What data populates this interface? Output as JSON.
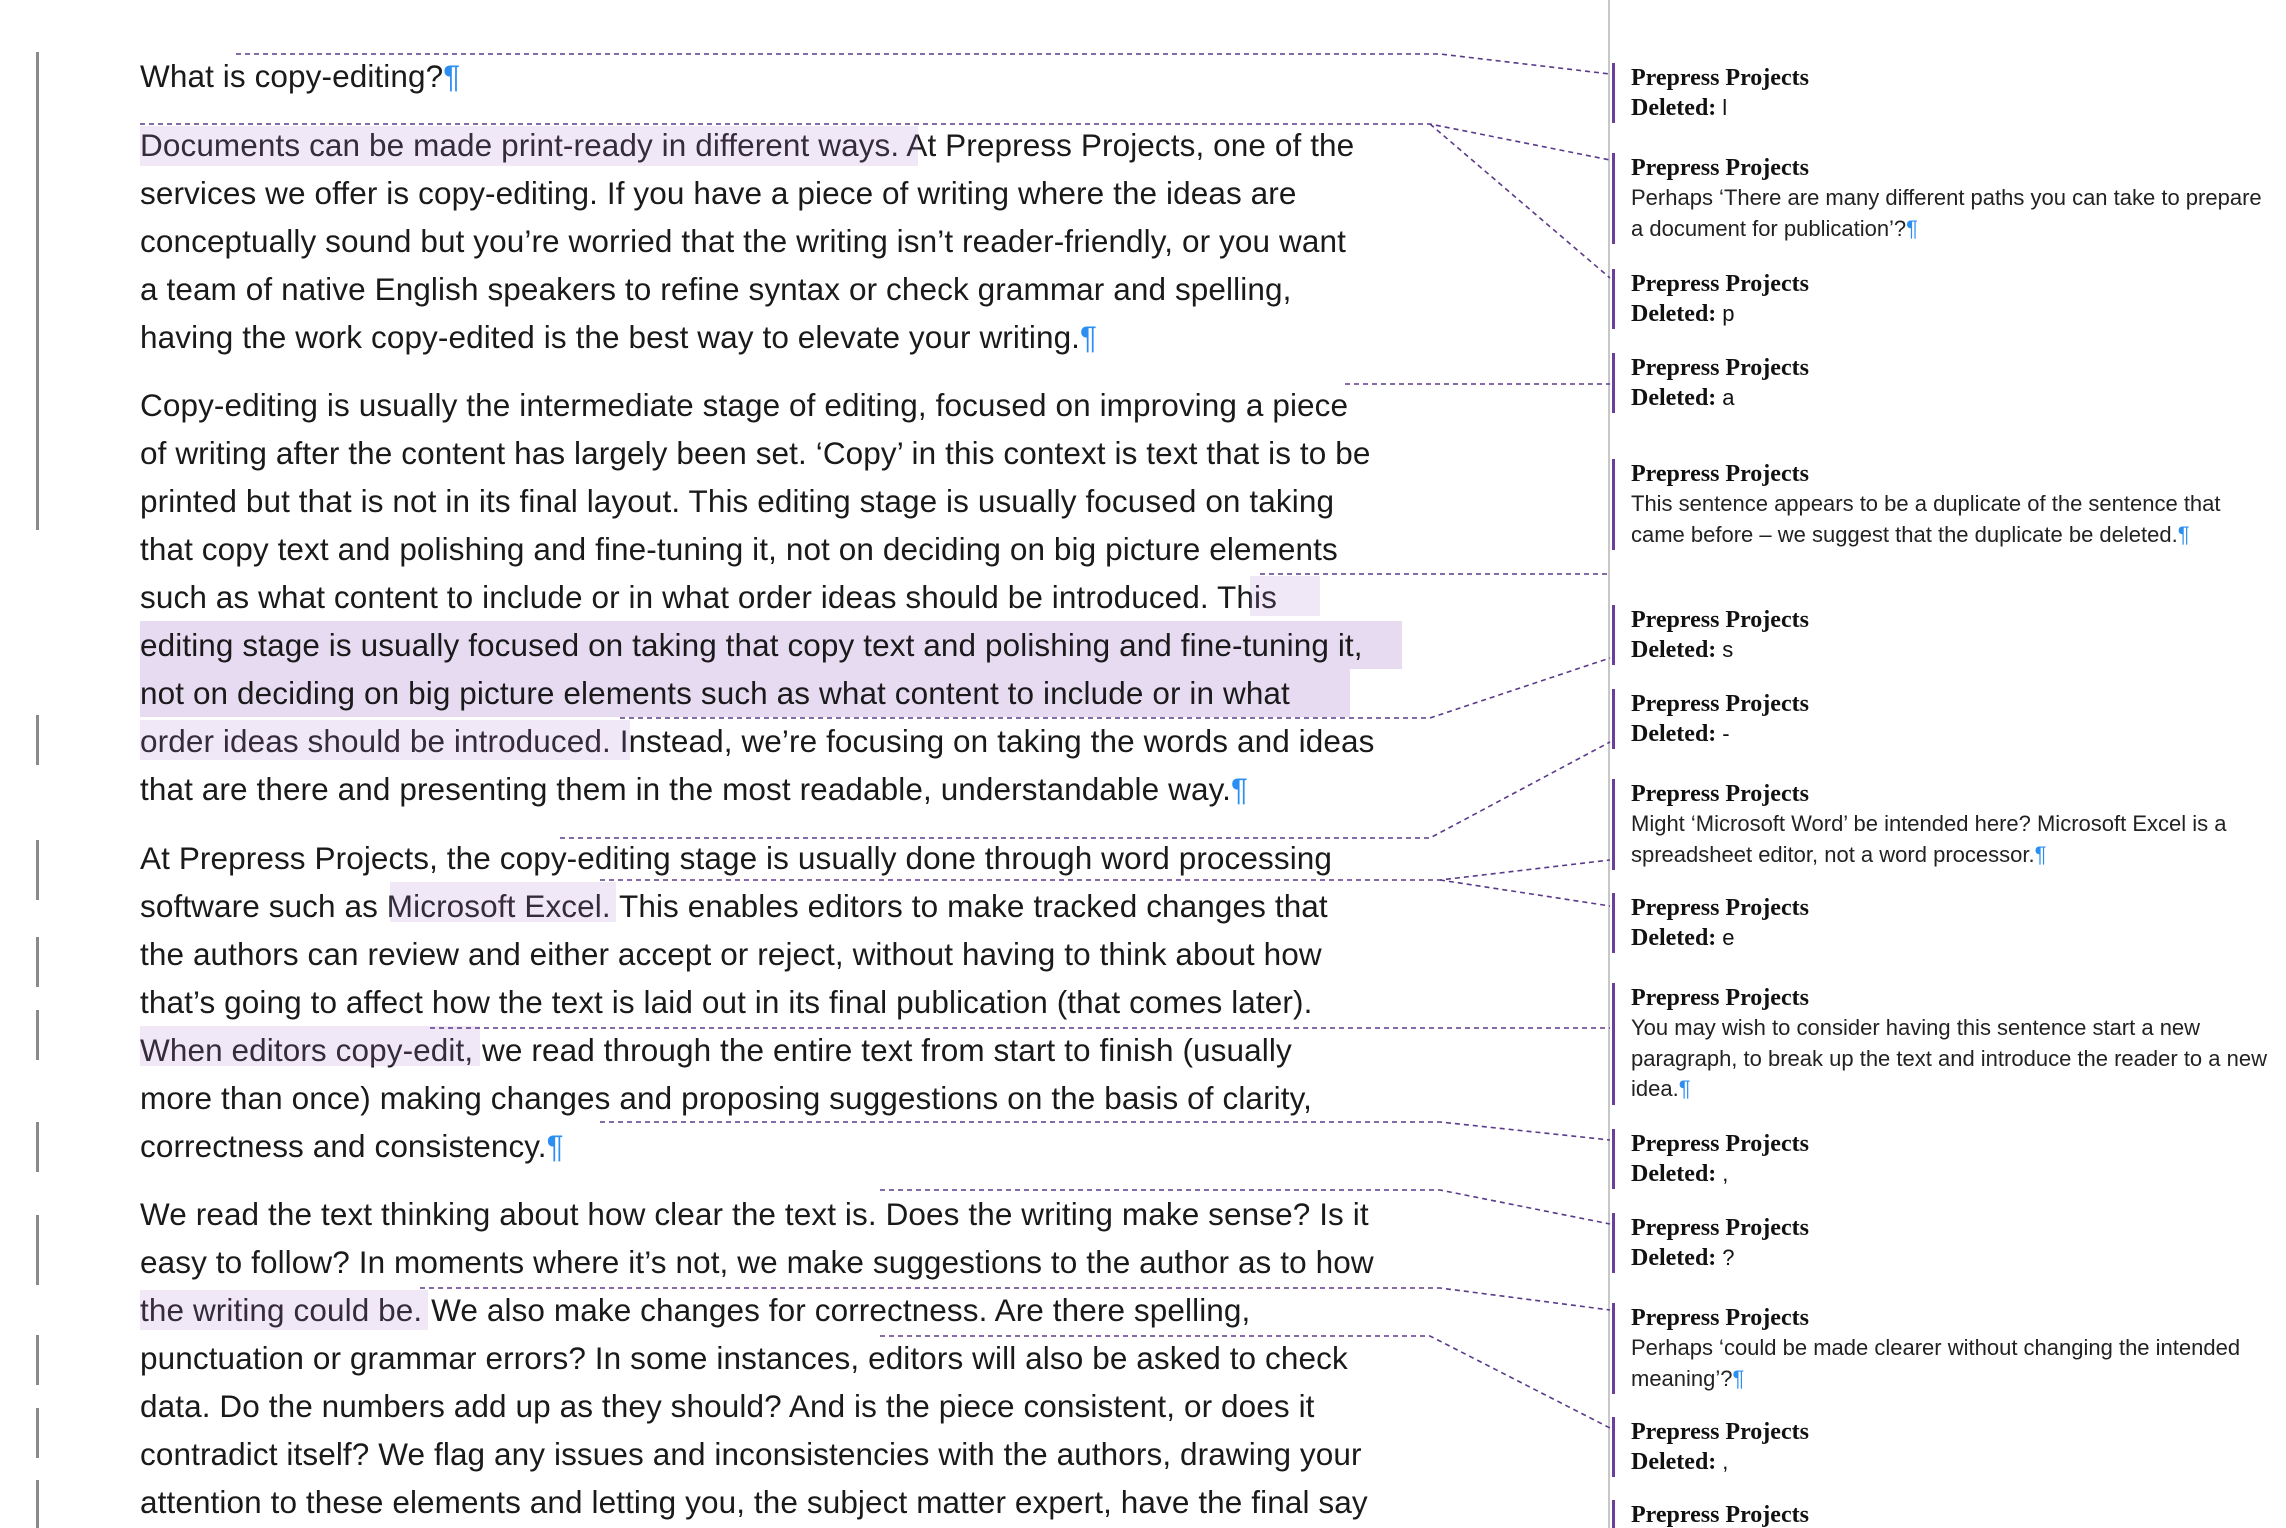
{
  "document": {
    "paragraphs": [
      {
        "lines": [
          "What is copy-editing?¶"
        ]
      },
      {
        "lines": [
          "Documents can be made print-ready in different ways. At Prepress Projects, one of the",
          "services we offer is copy-editing. If you have a piece of writing where the ideas are",
          "conceptually sound but you’re worried that the writing isn’t reader-friendly, or you want",
          "a team of native English speakers to refine syntax or check grammar and spelling,",
          "having the work copy-edited is the best way to elevate your writing.¶"
        ]
      },
      {
        "lines": [
          "Copy-editing is usually the intermediate stage of editing, focused on improving a piece",
          "of writing after the content has largely been set. ‘Copy’ in this context is text that is to be",
          "printed but that is not in its final layout. This editing stage is usually focused on taking",
          "that copy text and polishing and fine-tuning it, not on deciding on big picture elements",
          "such as what content to include or in what order ideas should be introduced. This",
          "editing stage is usually focused on taking that copy text and polishing and fine-tuning it,",
          "not on deciding on big picture elements such as what content to include or in what",
          "order ideas should be introduced. Instead, we’re focusing on taking the words and ideas",
          "that are there and presenting them in the most readable, understandable way.¶"
        ]
      },
      {
        "lines": [
          "At Prepress Projects, the copy-editing stage is usually done through word processing",
          "software such as Microsoft Excel. This enables editors to make tracked changes that",
          "the authors can review and either accept or reject, without having to think about how",
          "that’s going to affect how the text is laid out in its final publication (that comes later).",
          "When editors copy-edit, we read through the entire text from start to finish (usually",
          "more than once) making changes and proposing suggestions on the basis of clarity,",
          "correctness and consistency.¶"
        ]
      },
      {
        "lines": [
          "We read the text thinking about how clear the text is. Does the writing make sense? Is it",
          "easy to follow? In moments where it’s not, we make suggestions to the author as to how",
          "the writing could be. We also make changes for correctness. Are there spelling,",
          "punctuation or grammar errors? In some instances, editors will also be asked to check",
          "data. Do the numbers add up as they should? And is the piece consistent, or does it",
          "contradict itself? We flag any issues and inconsistencies with the authors, drawing your",
          "attention to these elements and letting you, the subject matter expert, have the final say"
        ]
      }
    ]
  },
  "markup_pane": {
    "balloons": [
      {
        "author": "Prepress Projects",
        "deleted_label": "Deleted:",
        "deleted_text": "l"
      },
      {
        "author": "Prepress Projects",
        "comment": "Perhaps ‘There are many different paths you can take to prepare a document for publication’?¶"
      },
      {
        "author": "Prepress Projects",
        "deleted_label": "Deleted:",
        "deleted_text": "p"
      },
      {
        "author": "Prepress Projects",
        "deleted_label": "Deleted:",
        "deleted_text": "a"
      },
      {
        "author": "Prepress Projects",
        "comment": "This sentence appears to be a duplicate of the sentence that came before – we suggest that the duplicate be deleted.¶"
      },
      {
        "author": "Prepress Projects",
        "deleted_label": "Deleted:",
        "deleted_text": "s"
      },
      {
        "author": "Prepress Projects",
        "deleted_label": "Deleted:",
        "deleted_text": "-"
      },
      {
        "author": "Prepress Projects",
        "comment": "Might ‘Microsoft Word’ be intended here? Microsoft Excel is a spreadsheet editor, not a word processor.¶"
      },
      {
        "author": "Prepress Projects",
        "deleted_label": "Deleted:",
        "deleted_text": "e"
      },
      {
        "author": "Prepress Projects",
        "comment": "You may wish to consider having this sentence start a new paragraph, to break up the text and introduce the reader to a new idea.¶"
      },
      {
        "author": "Prepress Projects",
        "deleted_label": "Deleted:",
        "deleted_text": ","
      },
      {
        "author": "Prepress Projects",
        "deleted_label": "Deleted:",
        "deleted_text": "?"
      },
      {
        "author": "Prepress Projects",
        "comment": "Perhaps ‘could be made clearer without changing the intended meaning’?¶"
      },
      {
        "author": "Prepress Projects",
        "deleted_label": "Deleted:",
        "deleted_text": ","
      },
      {
        "author": "Prepress Projects"
      }
    ]
  },
  "colors": {
    "comment_highlight": "#e7dbf2",
    "markup_accent": "#6b3f9a",
    "leader_line": "#5a3a8a",
    "pilcrow": "#2b8ef0",
    "change_bar": "#8a8a8a"
  }
}
